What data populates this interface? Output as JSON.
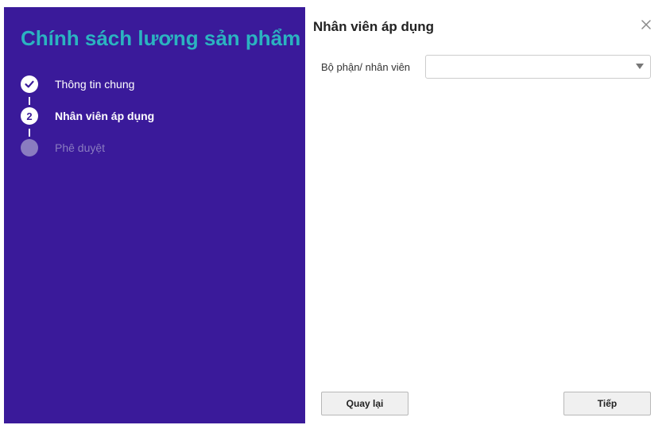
{
  "wizard": {
    "title": "Chính sách lương sản phẩm",
    "steps": [
      {
        "label": "Thông tin chung",
        "state": "completed",
        "icon": "check-icon"
      },
      {
        "label": "Nhân viên áp dụng",
        "state": "active",
        "number": "2"
      },
      {
        "label": "Phê duyệt",
        "state": "pending"
      }
    ]
  },
  "panel": {
    "title": "Nhân viên áp dụng",
    "close_icon": "close-icon",
    "field": {
      "label": "Bộ phận/ nhân viên",
      "value": ""
    },
    "buttons": {
      "back": "Quay lại",
      "next": "Tiếp"
    }
  },
  "colors": {
    "sidebar_bg": "#3a1a9a",
    "title_accent": "#2bb3c0",
    "pending_step": "#8a7cc0"
  }
}
